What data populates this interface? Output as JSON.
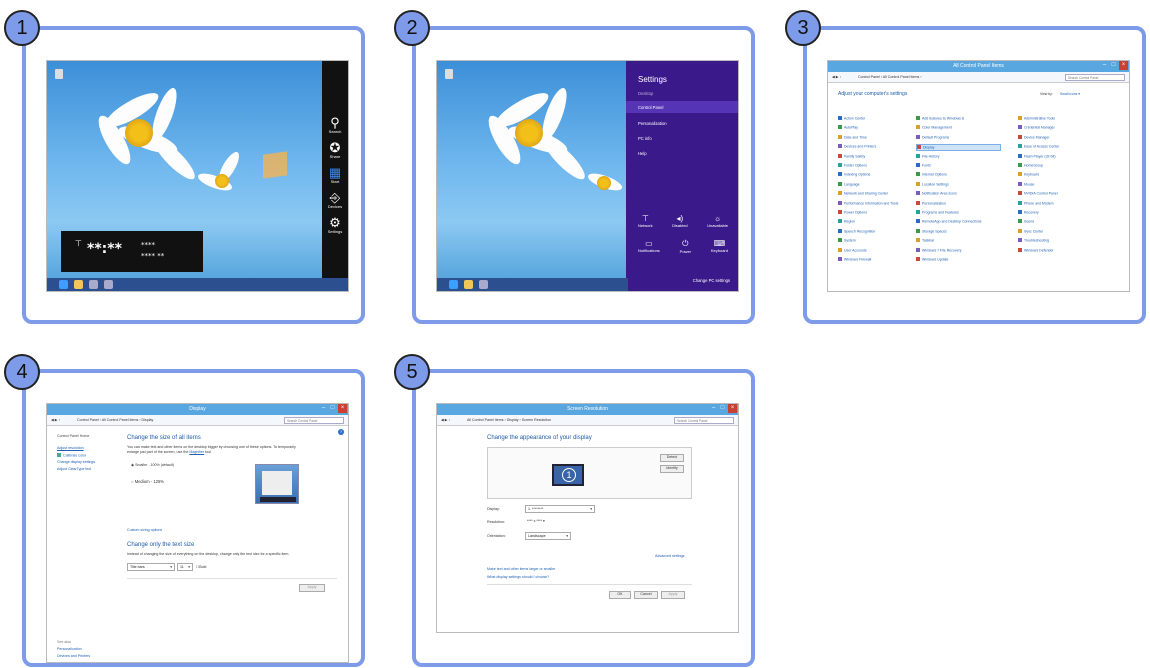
{
  "steps": [
    {
      "number": "1"
    },
    {
      "number": "2"
    },
    {
      "number": "3"
    },
    {
      "number": "4"
    },
    {
      "number": "5"
    }
  ],
  "step1": {
    "charms": [
      "Search",
      "Share",
      "Start",
      "Devices",
      "Settings"
    ],
    "clock_time": "**:**",
    "clock_date_line1": "****",
    "clock_date_line2": "**** **"
  },
  "step2": {
    "panel_title": "Settings",
    "items": [
      "Desktop",
      "Control Panel",
      "Personalization",
      "PC info",
      "Help"
    ],
    "quick_row1": [
      "Network",
      "Disabled",
      "Unavailable"
    ],
    "quick_row2": [
      "Notifications",
      "Power",
      "Keyboard"
    ],
    "change_pc_settings": "Change PC settings"
  },
  "step3": {
    "window_title": "All Control Panel Items",
    "address": "Control Panel  ›  All Control Panel Items  ›",
    "search_placeholder": "Search Control Panel",
    "heading": "Adjust your computer's settings",
    "view_by": "View by:",
    "view_by_value": "Small icons ▾",
    "col1": [
      "Action Center",
      "AutoPlay",
      "Date and Time",
      "Devices and Printers",
      "Family Safety",
      "Folder Options",
      "Indexing Options",
      "Language",
      "Network and Sharing Center",
      "Performance Information and Tools",
      "Power Options",
      "Region",
      "Speech Recognition",
      "System",
      "User Accounts",
      "Windows Firewall"
    ],
    "col2": [
      "Add features to Windows 8",
      "Color Management",
      "Default Programs",
      "Display",
      "File History",
      "Fonts",
      "Internet Options",
      "Location Settings",
      "Notification Area Icons",
      "Personalization",
      "Programs and Features",
      "RemoteApp and Desktop Connections",
      "Storage Spaces",
      "Taskbar",
      "Windows 7 File Recovery",
      "Windows Update"
    ],
    "col3": [
      "Administrative Tools",
      "Credential Manager",
      "Device Manager",
      "Ease of Access Center",
      "Flash Player (32-bit)",
      "HomeGroup",
      "Keyboard",
      "Mouse",
      "NVIDIA Control Panel",
      "Phone and Modem",
      "Recovery",
      "Sound",
      "Sync Center",
      "Troubleshooting",
      "Windows Defender"
    ]
  },
  "step4": {
    "window_title": "Display",
    "address": "Control Panel  ›  All Control Panel Items  ›  Display",
    "search_placeholder": "Search Control Panel",
    "sidebar": [
      "Control Panel Home",
      "Adjust resolution",
      "Calibrate color",
      "Change display settings",
      "Adjust ClearType text"
    ],
    "see_also": "See also",
    "see_also_items": [
      "Personalization",
      "Devices and Printers"
    ],
    "heading1": "Change the size of all items",
    "desc1a": "You can make text and other items on the desktop bigger by choosing one of these options. To temporarily",
    "desc1b": "enlarge just part of the screen, use the",
    "magnifier": "Magnifier",
    "tool": "tool.",
    "option1": "Smaller - 100% (default)",
    "option2": "Medium - 125%",
    "custom": "Custom sizing options",
    "heading2": "Change only the text size",
    "desc2": "Instead of changing the size of everything on the desktop, change only the text size for a specific item.",
    "item_select": "Title bars",
    "size_select": "11",
    "bold": "Bold",
    "apply": "Apply"
  },
  "step5": {
    "window_title": "Screen Resolution",
    "address": "All Control Panel Items  ›  Display  ›  Screen Resolution",
    "search_placeholder": "Search Control Panel",
    "heading": "Change the appearance of your display",
    "detect": "Detect",
    "identify": "Identify",
    "monitor_number": "1",
    "display_label": "Display:",
    "display_value": "1. ********",
    "resolution_label": "Resolution:",
    "resolution_value": "**** x **** ▾",
    "orientation_label": "Orientation:",
    "orientation_value": "Landscape",
    "advanced": "Advanced settings",
    "link1": "Make text and other items larger or smaller",
    "link2": "What display settings should I choose?",
    "ok": "OK",
    "cancel": "Cancel",
    "apply": "Apply"
  }
}
